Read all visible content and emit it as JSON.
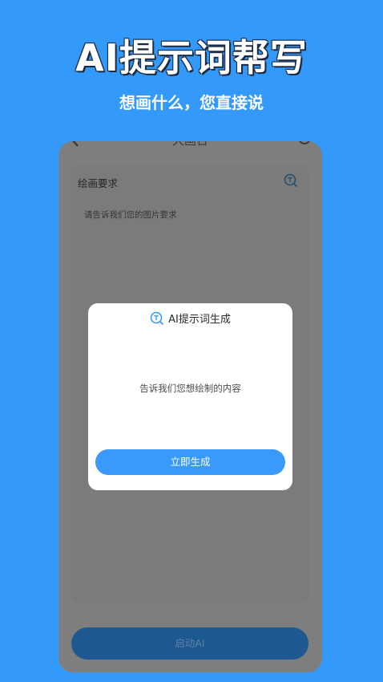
{
  "hero": {
    "title": "AI提示词帮写",
    "subtitle": "想画什么，您直接说"
  },
  "phone": {
    "topbar": {
      "title": "大画台"
    },
    "prompt_card": {
      "label": "绘画要求",
      "placeholder": "请告诉我们您的图片要求"
    },
    "start_button_label": "启动AI"
  },
  "dialog": {
    "title": "AI提示词生成",
    "message": "告诉我们您想绘制的内容",
    "generate_button_label": "立即生成"
  },
  "icons": {
    "back": "chevron-left-icon",
    "help": "help-circle-icon",
    "ai_magnifier": "ai-magnifier-icon"
  },
  "colors": {
    "background": "#3399fb",
    "accent": "#3a9afa",
    "start_button": "#1d5891"
  }
}
